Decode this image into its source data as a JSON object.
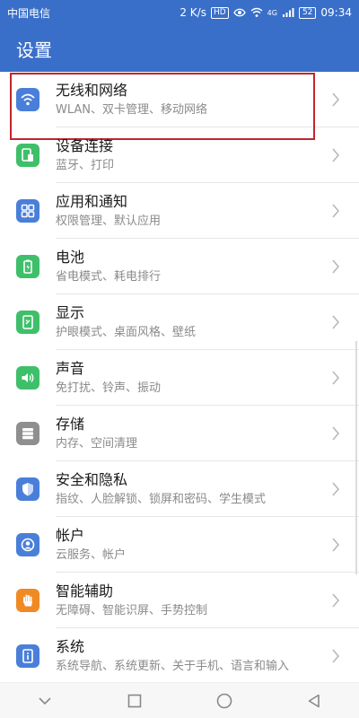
{
  "status_bar": {
    "carrier": "中国电信",
    "speed": "2 K/s",
    "hd": "HD",
    "network": "4G",
    "battery": "52",
    "time": "09:34"
  },
  "app_bar": {
    "title": "设置"
  },
  "settings": [
    {
      "title": "无线和网络",
      "subtitle": "WLAN、双卡管理、移动网络",
      "icon": "wifi-icon",
      "color": "#4a7fd9"
    },
    {
      "title": "设备连接",
      "subtitle": "蓝牙、打印",
      "icon": "device-connection-icon",
      "color": "#3fbf6a"
    },
    {
      "title": "应用和通知",
      "subtitle": "权限管理、默认应用",
      "icon": "apps-grid-icon",
      "color": "#4a7fd9"
    },
    {
      "title": "电池",
      "subtitle": "省电模式、耗电排行",
      "icon": "battery-icon",
      "color": "#3fbf6a"
    },
    {
      "title": "显示",
      "subtitle": "护眼模式、桌面风格、壁纸",
      "icon": "display-icon",
      "color": "#3fbf6a"
    },
    {
      "title": "声音",
      "subtitle": "免打扰、铃声、振动",
      "icon": "sound-icon",
      "color": "#3fbf6a"
    },
    {
      "title": "存储",
      "subtitle": "内存、空间清理",
      "icon": "storage-icon",
      "color": "#8f8f8f"
    },
    {
      "title": "安全和隐私",
      "subtitle": "指纹、人脸解锁、锁屏和密码、学生模式",
      "icon": "shield-icon",
      "color": "#4a7fd9"
    },
    {
      "title": "帐户",
      "subtitle": "云服务、帐户",
      "icon": "account-icon",
      "color": "#4a7fd9"
    },
    {
      "title": "智能辅助",
      "subtitle": "无障碍、智能识屏、手势控制",
      "icon": "hand-icon",
      "color": "#f08a24"
    },
    {
      "title": "系统",
      "subtitle": "系统导航、系统更新、关于手机、语言和输入",
      "icon": "system-info-icon",
      "color": "#4a7fd9"
    }
  ],
  "selected_index": 0
}
